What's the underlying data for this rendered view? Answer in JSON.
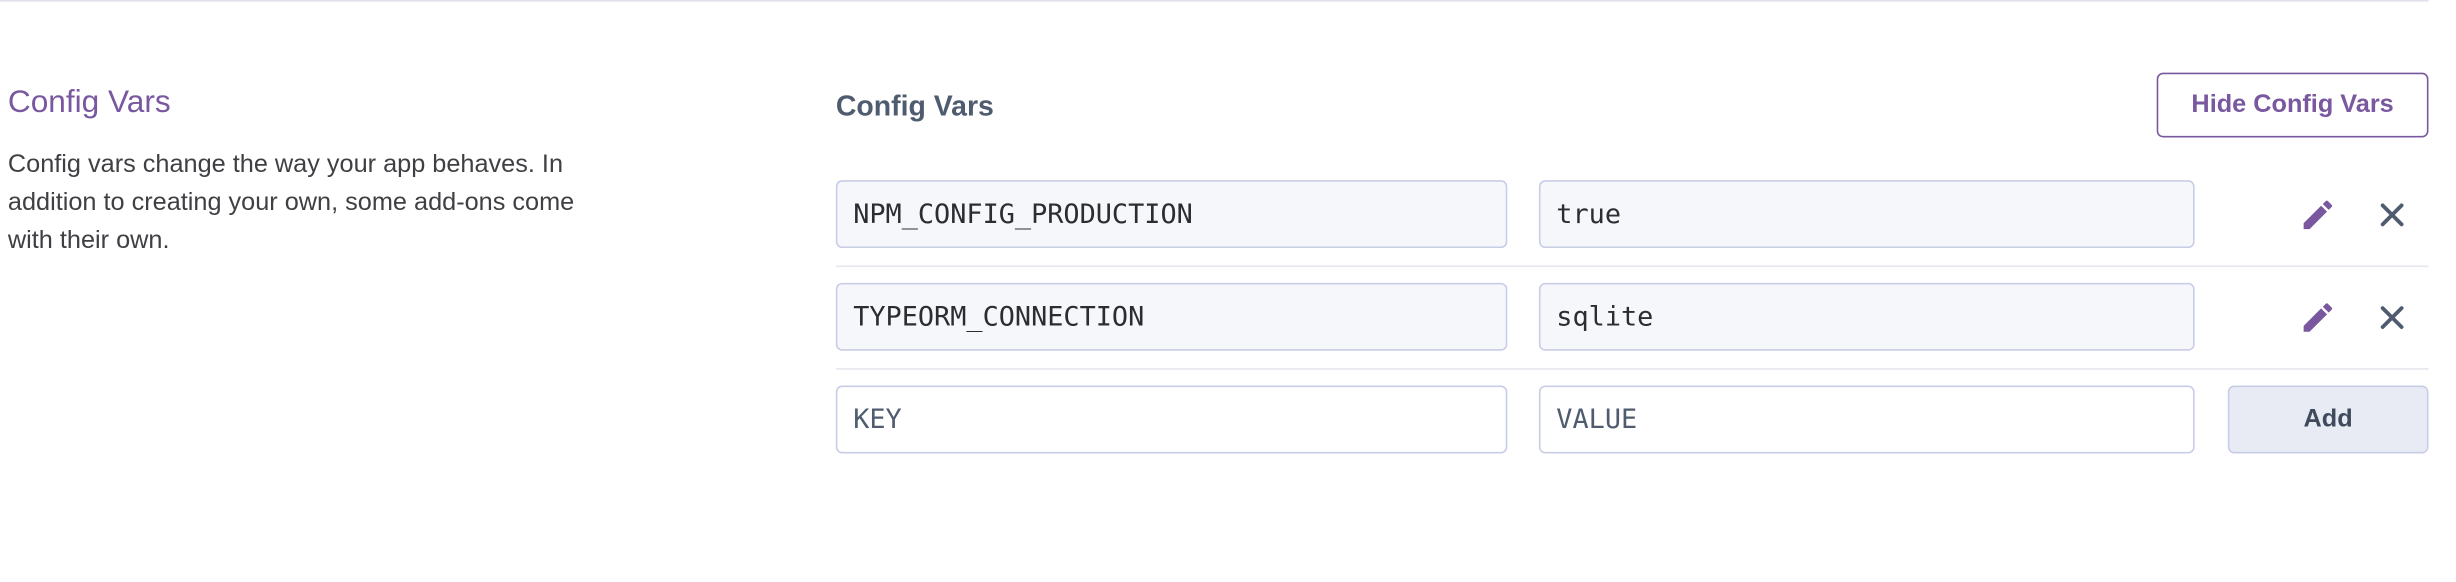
{
  "section": {
    "title": "Config Vars",
    "description": "Config vars change the way your app behaves. In addition to creating your own, some add-ons come with their own."
  },
  "panel": {
    "title": "Config Vars",
    "hide_button_label": "Hide Config Vars"
  },
  "config_vars": [
    {
      "key": "NPM_CONFIG_PRODUCTION",
      "value": "true"
    },
    {
      "key": "TYPEORM_CONNECTION",
      "value": "sqlite"
    }
  ],
  "new_var": {
    "key_placeholder": "KEY",
    "value_placeholder": "VALUE",
    "add_button_label": "Add"
  },
  "colors": {
    "accent": "#79589f",
    "icon_gray": "#4f5b6e",
    "border": "#c8cde6"
  },
  "icons": {
    "edit": "pencil-icon",
    "delete": "close-icon"
  }
}
